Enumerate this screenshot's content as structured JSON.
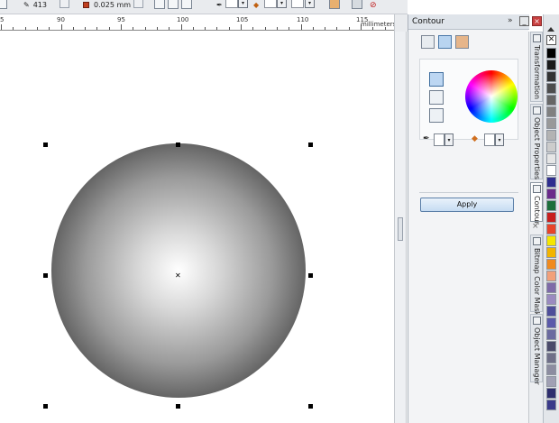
{
  "propbar": {
    "size_value": "413",
    "outline_width": "0.025 mm"
  },
  "ruler": {
    "labels": [
      "5",
      "90",
      "95",
      "100",
      "105",
      "110",
      "115"
    ],
    "unit": "millimeters"
  },
  "docker": {
    "title": "Contour",
    "more_symbol": "»",
    "apply_label": "Apply",
    "close_symbol": "×",
    "minimize_symbol": "_",
    "dropdown_symbol": "▾"
  },
  "vertical_tabs": [
    {
      "label": "Transformation",
      "active": false
    },
    {
      "label": "Object Properties",
      "active": false
    },
    {
      "label": "Contour",
      "active": true
    },
    {
      "label": "Bitmap Color Mask",
      "active": false
    },
    {
      "label": "Object Manager",
      "active": false
    }
  ],
  "palette": {
    "none_symbol": "✕",
    "colors": [
      "#000000",
      "#1a1a1a",
      "#333333",
      "#4d4d4d",
      "#666666",
      "#808080",
      "#999999",
      "#b3b3b3",
      "#cccccc",
      "#e6e6e6",
      "#ffffff",
      "#2e2e8f",
      "#6a2a8a",
      "#1c6e3a",
      "#c81e1e",
      "#e8432a",
      "#f5e600",
      "#f2b400",
      "#f08a1e",
      "#f2a07a",
      "#7e6aa8",
      "#9a8ac0",
      "#4e4e9a",
      "#5a5aaa",
      "#6a6aa0",
      "#4a4a6a",
      "#6f6f88",
      "#8c8ca0",
      "#a0a0b4",
      "#2e2e6e",
      "#3a3a8a"
    ]
  },
  "colors": {
    "accent": "#4a78a8",
    "panel_bg": "#f3f4f6",
    "apply_button": "#c6dcf2"
  }
}
